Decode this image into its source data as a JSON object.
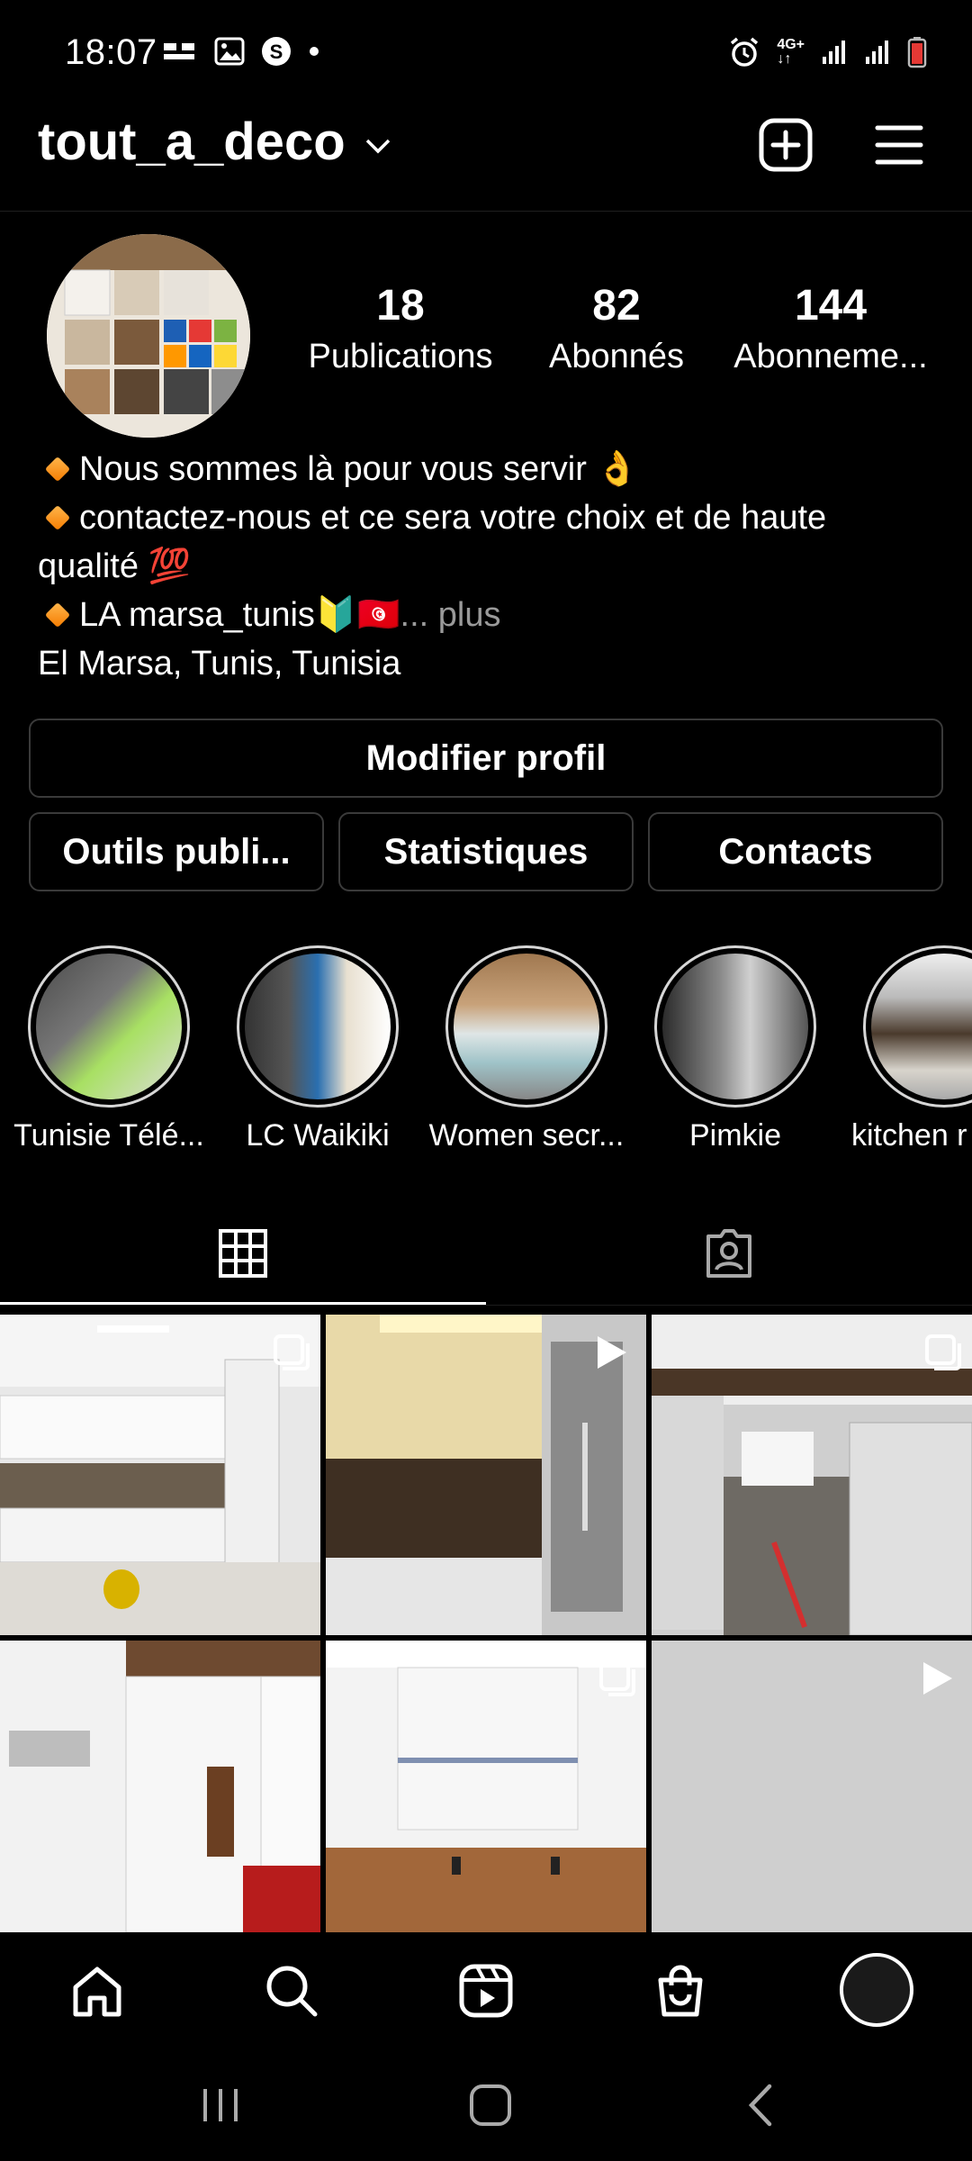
{
  "status_bar": {
    "time": "18:07",
    "left_icons": [
      "dual-sim-icon",
      "image-icon",
      "shazam-icon",
      "dot-icon"
    ],
    "right_icons": [
      "alarm-icon",
      "4g-icon",
      "signal-icon",
      "signal-icon",
      "battery-icon"
    ],
    "network": "4G+"
  },
  "header": {
    "username": "tout_a_deco"
  },
  "profile": {
    "stats": [
      {
        "value": "18",
        "label": "Publications"
      },
      {
        "value": "82",
        "label": "Abonnés"
      },
      {
        "value": "144",
        "label": "Abonneme..."
      }
    ],
    "bio_lines": [
      "Nous sommes là pour vous servir 👌",
      "contactez-nous et ce sera votre choix et de haute",
      "qualité 💯",
      " LA marsa_tunis🔰🇹🇳"
    ],
    "more": "... plus",
    "location": "El Marsa, Tunis, Tunisia"
  },
  "buttons": {
    "edit_profile": "Modifier profil",
    "tools": "Outils publi...",
    "stats": "Statistiques",
    "contacts": "Contacts"
  },
  "highlights": [
    {
      "label": "Tunisie Télé..."
    },
    {
      "label": "LC Waikiki"
    },
    {
      "label": "Women secr..."
    },
    {
      "label": "Pimkie"
    },
    {
      "label": "kitchen r"
    }
  ],
  "tabs": [
    "grid-icon",
    "tagged-icon"
  ],
  "colors": {
    "background": "#000000",
    "text": "#ffffff",
    "muted": "#9a9a9a",
    "border": "#3a3a3a",
    "diamond": "#f57c00"
  }
}
